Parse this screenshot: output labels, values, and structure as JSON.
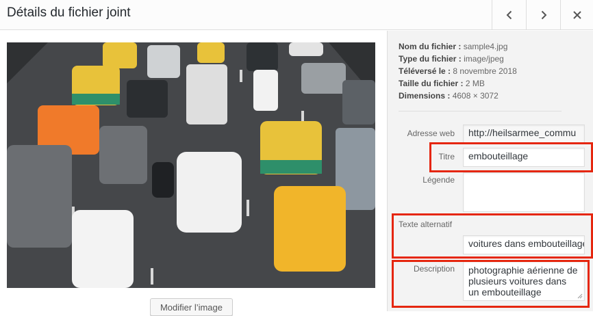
{
  "header": {
    "title": "Détails du fichier joint",
    "prev_icon": "chevron-left-icon",
    "next_icon": "chevron-right-icon",
    "close_icon": "close-icon"
  },
  "media": {
    "description": "aerial photo of cars in a traffic jam",
    "edit_button_label": "Modifier l’image"
  },
  "meta": [
    {
      "label": "Nom du fichier :",
      "value": "sample4.jpg"
    },
    {
      "label": "Type du fichier :",
      "value": "image/jpeg"
    },
    {
      "label": "Téléversé le :",
      "value": "8 novembre 2018"
    },
    {
      "label": "Taille du fichier :",
      "value": "2 MB"
    },
    {
      "label": "Dimensions :",
      "value": "4608 × 3072"
    }
  ],
  "fields": {
    "url": {
      "label": "Adresse web",
      "value": "http://heilsarmee_commu"
    },
    "title": {
      "label": "Titre",
      "value": "embouteillage"
    },
    "caption": {
      "label": "Légende",
      "value": ""
    },
    "alt": {
      "label": "Texte alternatif",
      "value": "voitures dans embouteillage"
    },
    "description": {
      "label": "Description",
      "value": "photographie aérienne de plusieurs voitures dans un embouteillage"
    }
  },
  "colors": {
    "highlight": "#e5260e",
    "panel": "#f3f3f3"
  }
}
